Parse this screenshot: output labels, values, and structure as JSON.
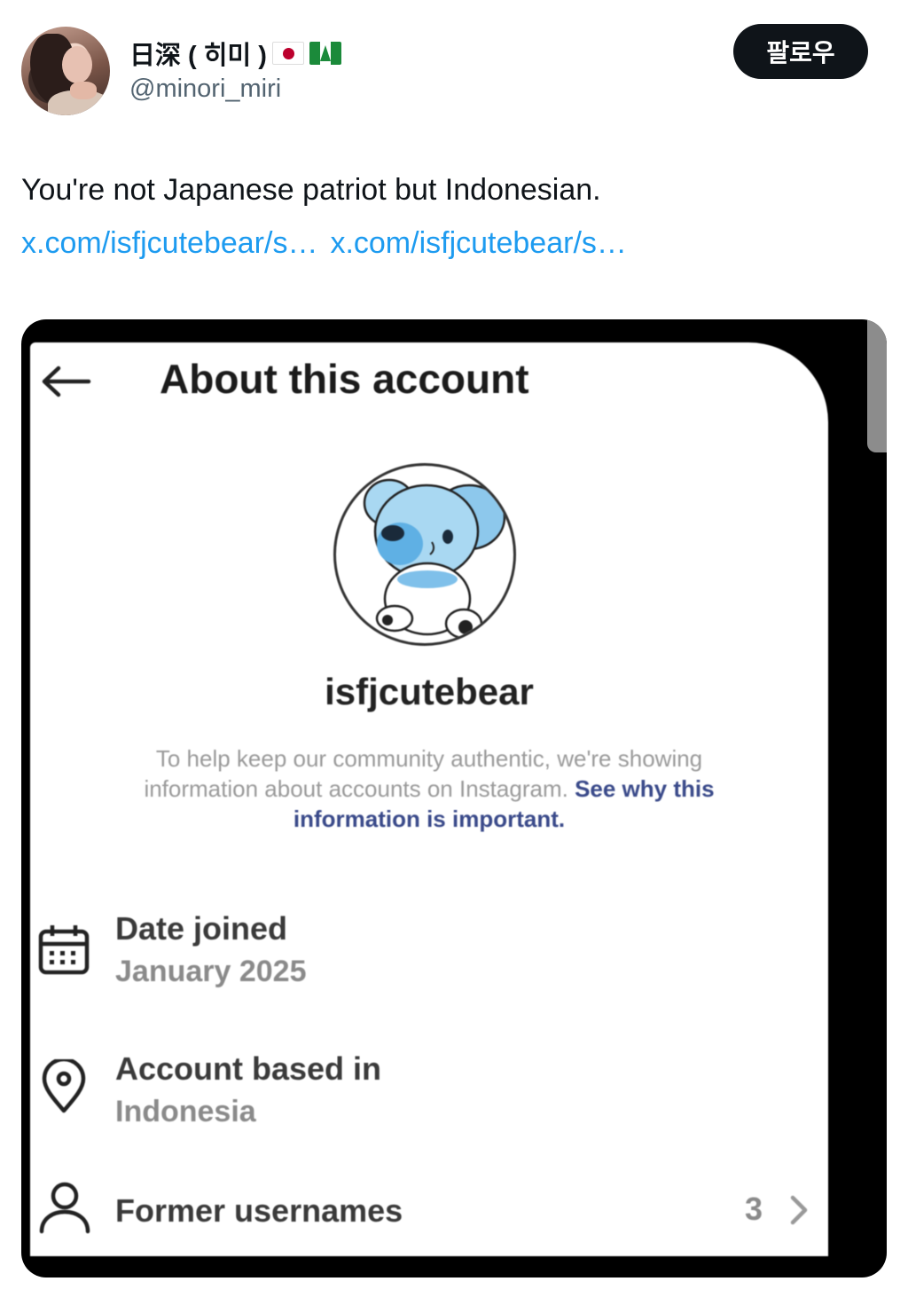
{
  "header": {
    "display_name": "日深 ( 히미 )",
    "handle": "@minori_miri",
    "follow_label": "팔로우"
  },
  "tweet": {
    "text": "You're not Japanese patriot but Indonesian.",
    "links": [
      "x.com/isfjcutebear/s…",
      "x.com/isfjcutebear/s…"
    ]
  },
  "screenshot": {
    "title": "About this account",
    "username": "isfjcutebear",
    "info_text": "To help keep our community authentic, we're showing information about accounts on Instagram.",
    "info_link": "See why this information is important.",
    "date_joined_label": "Date joined",
    "date_joined_value": "January 2025",
    "based_in_label": "Account based in",
    "based_in_value": "Indonesia",
    "former_usernames_label": "Former usernames",
    "former_usernames_count": "3"
  },
  "colors": {
    "link": "#1d9bf0",
    "follow_bg": "#0f1419",
    "text": "#0f1419",
    "muted": "#536471"
  },
  "icons": [
    "japan-flag-icon",
    "norfolk-island-flag-icon",
    "back-arrow-icon",
    "calendar-icon",
    "location-pin-icon",
    "person-icon",
    "chevron-right-icon"
  ]
}
